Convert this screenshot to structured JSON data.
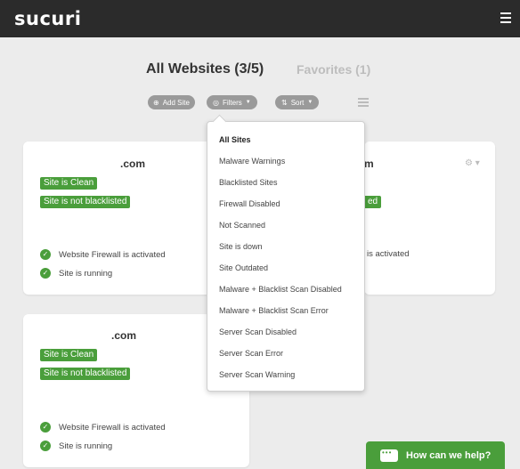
{
  "header": {
    "logo": "sucuri",
    "menu_icon": "hamburger-icon"
  },
  "tabs": {
    "all": "All Websites (3/5)",
    "favorites": "Favorites (1)"
  },
  "toolbar": {
    "add_site": "Add Site",
    "filters": "Filters",
    "sort": "Sort",
    "icons": {
      "add": "plus-circle-icon",
      "filters": "eye-slash-icon",
      "sort": "sort-icon",
      "list": "list-view-icon"
    }
  },
  "filters_menu": {
    "items": [
      "All Sites",
      "Malware Warnings",
      "Blacklisted Sites",
      "Firewall Disabled",
      "Not Scanned",
      "Site is down",
      "Site Outdated",
      "Malware + Blacklist Scan Disabled",
      "Malware + Blacklist Scan Error",
      "Server Scan Disabled",
      "Server Scan Error",
      "Server Scan Warning"
    ],
    "active": "All Sites"
  },
  "sites": [
    {
      "domain_suffix": ".com",
      "tags": [
        "Site is Clean",
        "Site is not blacklisted"
      ],
      "statuses": [
        "Website Firewall is activated",
        "Site is running"
      ]
    },
    {
      "domain_suffix": "m",
      "tags": [
        "ed"
      ],
      "statuses": [
        "is activated"
      ]
    },
    {
      "domain_suffix": ".com",
      "tags": [
        "Site is Clean",
        "Site is not blacklisted"
      ],
      "statuses": [
        "Website Firewall is activated",
        "Site is running"
      ]
    }
  ],
  "help": {
    "label": "How can we help?"
  },
  "colors": {
    "topbar": "#2b2b2b",
    "accent_green": "#4a9e3b",
    "pill_gray": "#9a9a9a",
    "background": "#ececec"
  }
}
